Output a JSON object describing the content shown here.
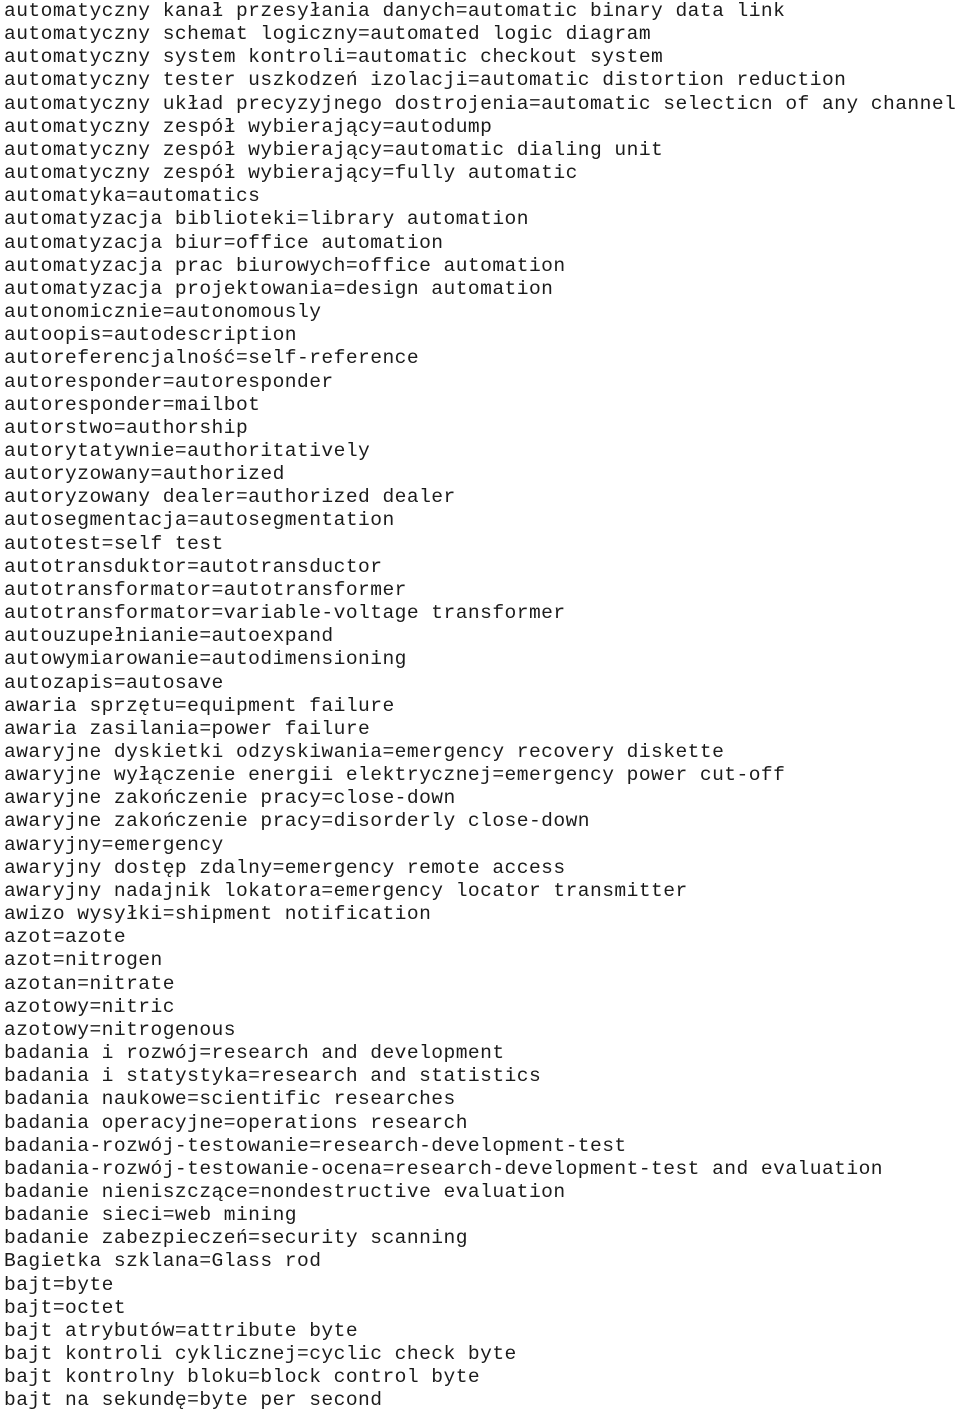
{
  "document": {
    "kind": "plain-text-glossary",
    "language_pair": "Polish=English",
    "separator": "=",
    "text_color": "#1b1b1b",
    "background_color": "#ffffff",
    "line_count": 61,
    "lines": [
      "automatyczny kanał przesyłania danych=automatic binary data link",
      "automatyczny schemat logiczny=automated logic diagram",
      "automatyczny system kontroli=automatic checkout system",
      "automatyczny tester uszkodzeń izolacji=automatic distortion reduction",
      "automatyczny układ precyzyjnego dostrojenia=automatic selecticn of any channel",
      "automatyczny zespół wybierający=autodump",
      "automatyczny zespół wybierający=automatic dialing unit",
      "automatyczny zespół wybierający=fully automatic",
      "automatyka=automatics",
      "automatyzacja biblioteki=library automation",
      "automatyzacja biur=office automation",
      "automatyzacja prac biurowych=office automation",
      "automatyzacja projektowania=design automation",
      "autonomicznie=autonomously",
      "autoopis=autodescription",
      "autoreferencjalność=self-reference",
      "autoresponder=autoresponder",
      "autoresponder=mailbot",
      "autorstwo=authorship",
      "autorytatywnie=authoritatively",
      "autoryzowany=authorized",
      "autoryzowany dealer=authorized dealer",
      "autosegmentacja=autosegmentation",
      "autotest=self test",
      "autotransduktor=autotransductor",
      "autotransformator=autotransformer",
      "autotransformator=variable-voltage transformer",
      "autouzupełnianie=autoexpand",
      "autowymiarowanie=autodimensioning",
      "autozapis=autosave",
      "awaria sprzętu=equipment failure",
      "awaria zasilania=power failure",
      "awaryjne dyskietki odzyskiwania=emergency recovery diskette",
      "awaryjne wyłączenie energii elektrycznej=emergency power cut-off",
      "awaryjne zakończenie pracy=close-down",
      "awaryjne zakończenie pracy=disorderly close-down",
      "awaryjny=emergency",
      "awaryjny dostęp zdalny=emergency remote access",
      "awaryjny nadajnik lokatora=emergency locator transmitter",
      "awizo wysyłki=shipment notification",
      "azot=azote",
      "azot=nitrogen",
      "azotan=nitrate",
      "azotowy=nitric",
      "azotowy=nitrogenous",
      "badania i rozwój=research and development",
      "badania i statystyka=research and statistics",
      "badania naukowe=scientific researches",
      "badania operacyjne=operations research",
      "badania-rozwój-testowanie=research-development-test",
      "badania-rozwój-testowanie-ocena=research-development-test and evaluation",
      "badanie nieniszczące=nondestructive evaluation",
      "badanie sieci=web mining",
      "badanie zabezpieczeń=security scanning",
      "Bagietka szklana=Glass rod",
      "bajt=byte",
      "bajt=octet",
      "bajt atrybutów=attribute byte",
      "bajt kontroli cyklicznej=cyclic check byte",
      "bajt kontrolny bloku=block control byte",
      "bajt na sekundę=byte per second"
    ]
  }
}
